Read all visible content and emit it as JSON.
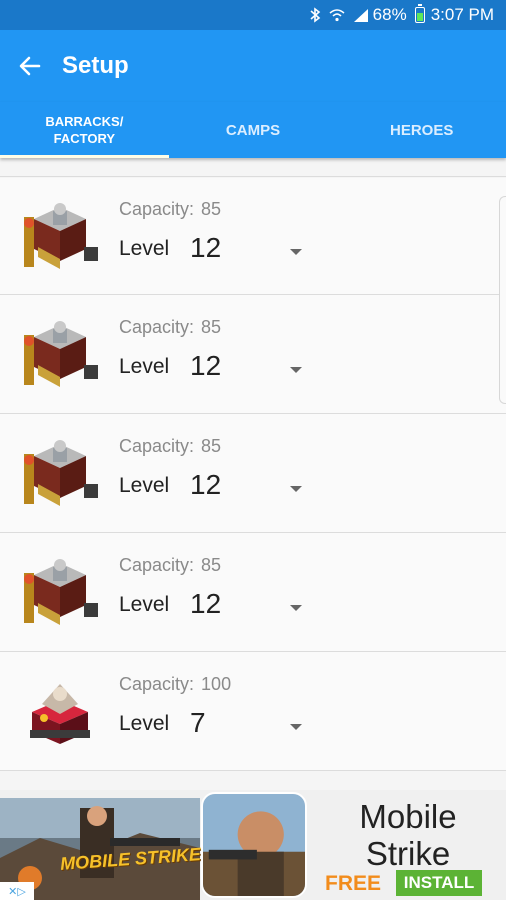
{
  "status_bar": {
    "battery_percent": "68%",
    "time": "3:07 PM"
  },
  "app_bar": {
    "title": "Setup"
  },
  "tabs": [
    {
      "label": "BARRACKS/\nFACTORY",
      "active": true
    },
    {
      "label": "CAMPS",
      "active": false
    },
    {
      "label": "HEROES",
      "active": false
    }
  ],
  "buildings": [
    {
      "capacity_label": "Capacity:",
      "capacity": "85",
      "level_label": "Level",
      "level": "12",
      "icon": "barracks-icon"
    },
    {
      "capacity_label": "Capacity:",
      "capacity": "85",
      "level_label": "Level",
      "level": "12",
      "icon": "barracks-icon"
    },
    {
      "capacity_label": "Capacity:",
      "capacity": "85",
      "level_label": "Level",
      "level": "12",
      "icon": "barracks-icon"
    },
    {
      "capacity_label": "Capacity:",
      "capacity": "85",
      "level_label": "Level",
      "level": "12",
      "icon": "barracks-icon"
    },
    {
      "capacity_label": "Capacity:",
      "capacity": "100",
      "level_label": "Level",
      "level": "7",
      "icon": "spell-factory-icon"
    }
  ],
  "ad": {
    "title": "Mobile Strike",
    "free_label": "FREE",
    "install_label": "INSTALL",
    "scene_text": "MOBILE STRIKE"
  },
  "colors": {
    "primary": "#2196f3",
    "status_bar": "#1a78c9",
    "install_green": "#5cb335",
    "free_orange": "#f28c1c"
  }
}
